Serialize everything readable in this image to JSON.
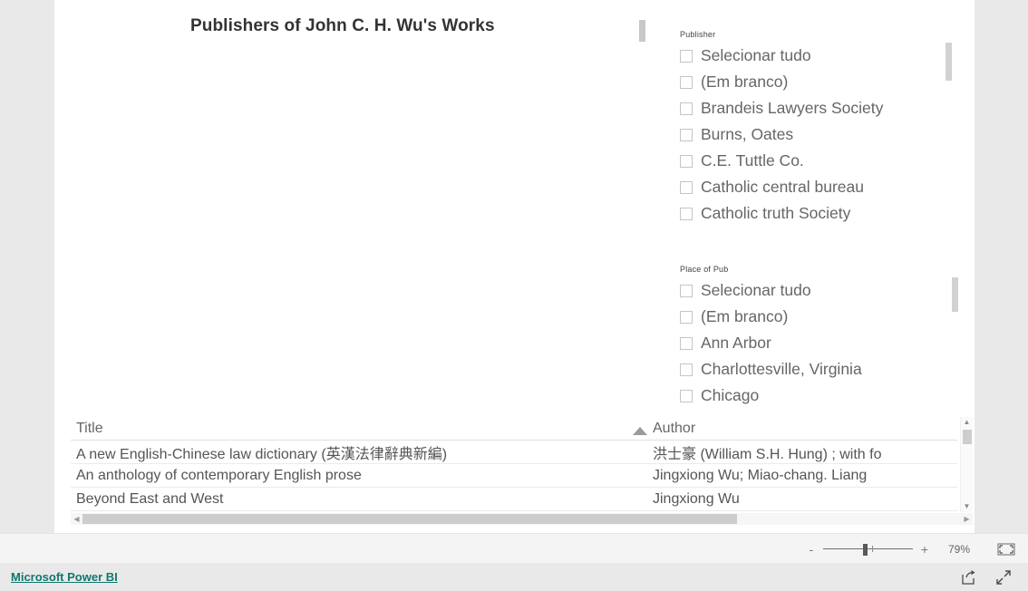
{
  "report": {
    "title": "Publishers of John C. H. Wu's Works"
  },
  "slicers": [
    {
      "name": "publisher",
      "header": "Publisher",
      "items": [
        "Selecionar tudo",
        "(Em branco)",
        "Brandeis Lawyers Society",
        "Burns, Oates",
        "C.E. Tuttle Co.",
        "Catholic central bureau",
        "Catholic truth Society"
      ]
    },
    {
      "name": "place_of_pub",
      "header": "Place of Pub",
      "items": [
        "Selecionar tudo",
        "(Em branco)",
        "Ann Arbor",
        "Charlottesville, Virginia",
        "Chicago"
      ]
    }
  ],
  "table": {
    "columns": [
      "Title",
      "Author"
    ],
    "sorted_column": "Author",
    "sort_direction": "ascending",
    "rows": [
      {
        "title": "A new English-Chinese law dictionary (英漢法律辭典新編)",
        "author": "洪士豪 (William S.H. Hung) ; with fo"
      },
      {
        "title": "An anthology of contemporary English prose",
        "author": "Jingxiong Wu; Miao-chang. Liang"
      },
      {
        "title": "Beyond East and West",
        "author": "Jingxiong Wu"
      }
    ]
  },
  "status_bar": {
    "zoom_out_label": "-",
    "zoom_in_label": "+",
    "zoom_value": "79%",
    "fit_page_name": "fit-to-page"
  },
  "footer": {
    "brand_link": "Microsoft Power BI",
    "share_name": "share",
    "fullscreen_name": "fullscreen"
  },
  "colors": {
    "brand_teal": "#11776f",
    "canvas": "#ffffff",
    "page_background": "#e9e9e9",
    "text_gray": "#666666",
    "title_gray": "#333333"
  }
}
